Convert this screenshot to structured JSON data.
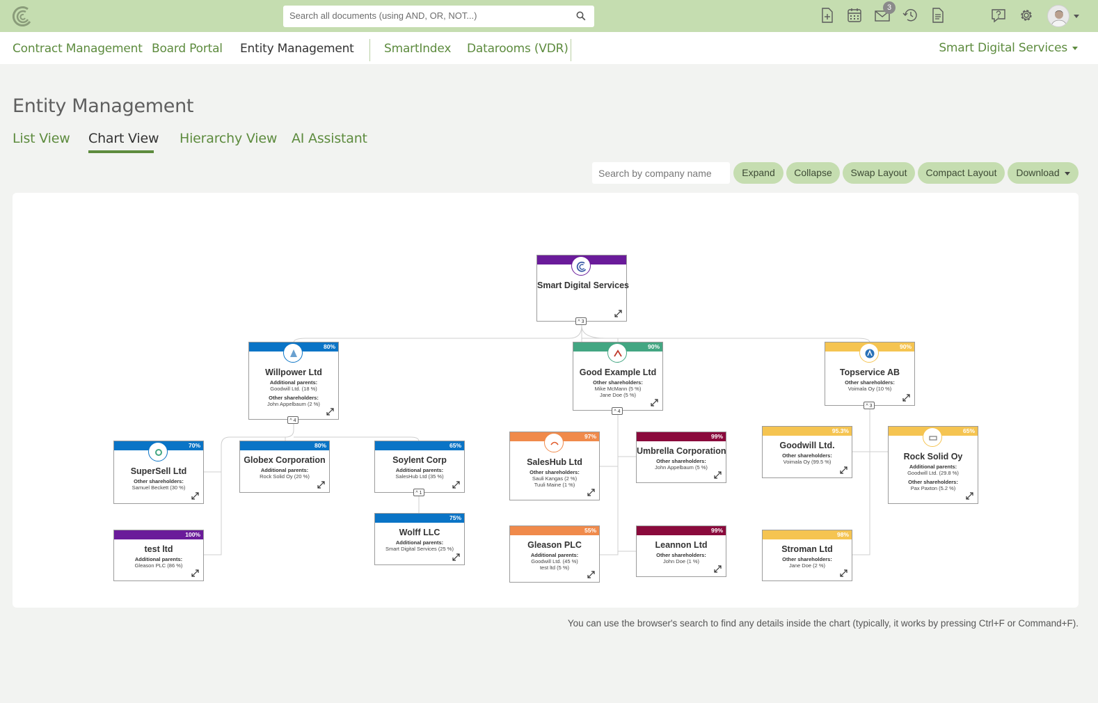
{
  "colors": {
    "topbar": "#c5ddb0",
    "accent": "#5d8b3e",
    "purple": "#6a1b9a",
    "blue": "#0a74c6",
    "teal": "#43a682",
    "yellow": "#f5c451",
    "orange": "#f08a4b",
    "maroon": "#8a0a3c"
  },
  "search": {
    "placeholder": "Search all documents (using AND, OR, NOT...)"
  },
  "toolbar_icons": [
    "add-document-icon",
    "calendar-icon",
    "mail-icon",
    "history-icon",
    "document-list-icon",
    "help-icon",
    "gear-icon"
  ],
  "notifications": {
    "mail_count": "3"
  },
  "modules": [
    {
      "label": "Contract Management"
    },
    {
      "label": "Board Portal"
    },
    {
      "label": "Entity Management"
    },
    {
      "label": "SmartIndex"
    },
    {
      "label": "Datarooms (VDR)"
    }
  ],
  "organization": "Smart Digital Services",
  "page": {
    "title": "Entity Management"
  },
  "view_tabs": [
    {
      "label": "List View"
    },
    {
      "label": "Chart View"
    },
    {
      "label": "Hierarchy View"
    },
    {
      "label": "AI Assistant"
    }
  ],
  "company_search": {
    "placeholder": "Search by company name"
  },
  "actions": {
    "expand": "Expand",
    "collapse": "Collapse",
    "swap": "Swap Layout",
    "compact": "Compact Layout",
    "download": "Download"
  },
  "org_chart": {
    "root": {
      "name": "Smart Digital Services",
      "children_count": "3"
    },
    "nodes": {
      "willpower": {
        "name": "Willpower Ltd",
        "percent": "80%",
        "l1": "Additional parents:",
        "v1": [
          "Goodwill Ltd. (18 %)"
        ],
        "l2": "Other shareholders:",
        "v2": [
          "John Appelbaum (2 %)"
        ],
        "children_count": "4"
      },
      "goodexample": {
        "name": "Good Example Ltd",
        "percent": "90%",
        "l1": "Other shareholders:",
        "v1": [
          "Mike McMann (5 %)",
          "Jane Doe (5 %)"
        ],
        "children_count": "4"
      },
      "topservice": {
        "name": "Topservice AB",
        "percent": "90%",
        "l1": "Other shareholders:",
        "v1": [
          "Voimala Oy (10 %)"
        ],
        "children_count": "3"
      },
      "supersell": {
        "name": "SuperSell Ltd",
        "percent": "70%",
        "l1": "Other shareholders:",
        "v1": [
          "Samuel Beckett (30 %)"
        ]
      },
      "globex": {
        "name": "Globex Corporation",
        "percent": "80%",
        "l1": "Additional parents:",
        "v1": [
          "Rock Solid Oy (20 %)"
        ]
      },
      "soylent": {
        "name": "Soylent Corp",
        "percent": "65%",
        "l1": "Additional parents:",
        "v1": [
          "SalesHub Ltd (35 %)"
        ],
        "children_count": "1"
      },
      "wolff": {
        "name": "Wolff LLC",
        "percent": "75%",
        "l1": "Additional parents:",
        "v1": [
          "Smart Digital Services (25 %)"
        ]
      },
      "testltd": {
        "name": "test ltd",
        "percent": "100%",
        "l1": "Additional parents:",
        "v1": [
          "Gleason PLC (86 %)"
        ]
      },
      "saleshub": {
        "name": "SalesHub Ltd",
        "percent": "97%",
        "l1": "Other shareholders:",
        "v1": [
          "Sauli Kangas (2 %)",
          "Tuuli Maine (1 %)"
        ]
      },
      "umbrella": {
        "name": "Umbrella Corporation",
        "percent": "99%",
        "l1": "Other shareholders:",
        "v1": [
          "John Appelbaum (5 %)"
        ]
      },
      "gleason": {
        "name": "Gleason PLC",
        "percent": "55%",
        "l1": "Additional parents:",
        "v1": [
          "Goodwill Ltd. (45 %)",
          "test ltd (5 %)"
        ]
      },
      "leannon": {
        "name": "Leannon Ltd",
        "percent": "99%",
        "l1": "Other shareholders:",
        "v1": [
          "John Doe (1 %)"
        ]
      },
      "goodwill": {
        "name": "Goodwill Ltd.",
        "percent": "95.3%",
        "l1": "Other shareholders:",
        "v1": [
          "Voimala Oy (99.5 %)"
        ]
      },
      "rocksolid": {
        "name": "Rock Solid Oy",
        "percent": "65%",
        "l1": "Additional parents:",
        "v1": [
          "Goodwill Ltd. (29.8 %)"
        ],
        "l2": "Other shareholders:",
        "v2": [
          "Pax Paxton (5.2 %)"
        ]
      },
      "stroman": {
        "name": "Stroman Ltd",
        "percent": "98%",
        "l1": "Other shareholders:",
        "v1": [
          "Jane Doe (2 %)"
        ]
      }
    }
  },
  "footer_note": "You can use the browser's search to find any details inside the chart (typically, it works by pressing Ctrl+F or Command+F)."
}
